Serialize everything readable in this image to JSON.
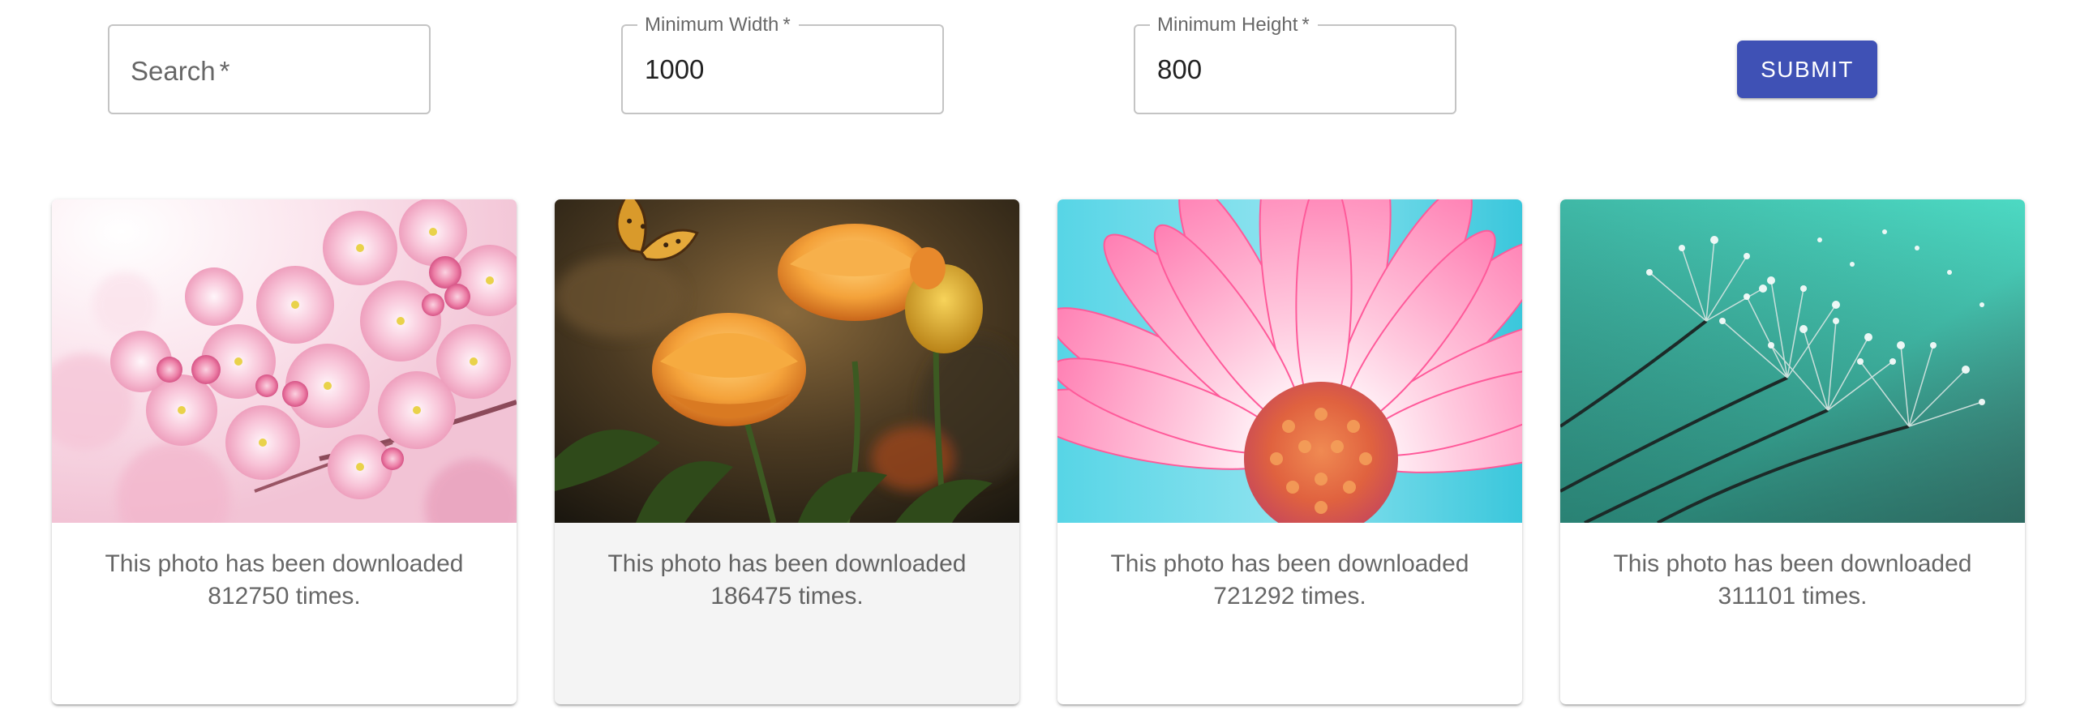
{
  "search_form": {
    "search": {
      "label": "Search",
      "required_mark": "*",
      "value": ""
    },
    "min_width": {
      "label": "Minimum Width",
      "required_mark": "*",
      "value": "1000"
    },
    "min_height": {
      "label": "Minimum Height",
      "required_mark": "*",
      "value": "800"
    },
    "submit_label": "SUBMIT"
  },
  "colors": {
    "primary": "#3f51b5",
    "hovered_card": "#f4f4f4"
  },
  "photos": [
    {
      "subject": "pink cherry blossoms",
      "caption_line1": "This photo has been downloaded",
      "caption_line2": "812750 times."
    },
    {
      "subject": "orange flowers with butterfly",
      "caption_line1": "This photo has been downloaded",
      "caption_line2": "186475 times."
    },
    {
      "subject": "pink daisy close-up",
      "caption_line1": "This photo has been downloaded",
      "caption_line2": "721292 times."
    },
    {
      "subject": "dandelion seeds with water drops",
      "caption_line1": "This photo has been downloaded",
      "caption_line2": "311101 times."
    }
  ]
}
